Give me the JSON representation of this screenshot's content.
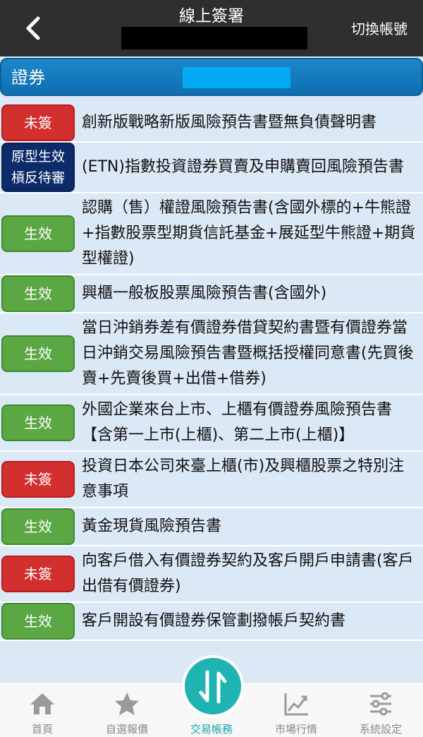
{
  "header": {
    "title": "線上簽署",
    "switch_label": "切換帳號"
  },
  "section": {
    "label": "證券"
  },
  "documents": [
    {
      "status": "未簽",
      "status_color": "red",
      "title": "創新版戰略新版風險預告書暨無負債聲明書"
    },
    {
      "status": "原型生效\n槓反待審",
      "status_color": "navy",
      "title": "(ETN)指數投資證券買賣及申購賣回風險預告書"
    },
    {
      "status": "生效",
      "status_color": "green",
      "title": "認購（售）權證風險預告書(含國外標的+牛熊證+指數股票型期貨信託基金+展延型牛熊證+期貨型權證)"
    },
    {
      "status": "生效",
      "status_color": "green",
      "title": "興櫃一般板股票風險預告書(含國外)"
    },
    {
      "status": "生效",
      "status_color": "green",
      "title": "當日沖銷券差有價證券借貸契約書暨有價證券當日沖銷交易風險預告書暨概括授權同意書(先買後賣+先賣後買+出借+借券)"
    },
    {
      "status": "生效",
      "status_color": "green",
      "title": "外國企業來台上市、上櫃有價證券風險預告書【含第一上市(上櫃)、第二上市(上櫃)】"
    },
    {
      "status": "未簽",
      "status_color": "red",
      "title": "投資日本公司來臺上櫃(市)及興櫃股票之特別注意事項"
    },
    {
      "status": "生效",
      "status_color": "green",
      "title": "黃金現貨風險預告書"
    },
    {
      "status": "未簽",
      "status_color": "red",
      "title": "向客戶借入有價證券契約及客戶開戶申請書(客戶出借有價證券)"
    },
    {
      "status": "生效",
      "status_color": "green",
      "title": "客戶開設有價證券保管劃撥帳戶契約書"
    }
  ],
  "nav": {
    "home": "首頁",
    "watchlist": "自選報價",
    "trade": "交易帳務",
    "market": "市場行情",
    "settings": "系統設定"
  },
  "colors": {
    "header_bg": "#2f2f2f",
    "section_bar": "#1677bd",
    "row_bg": "#dbe8f5",
    "status_red": "#d32f2f",
    "status_green": "#5aa744",
    "status_navy": "#0d2b6b",
    "accent": "#1fb3b3"
  }
}
